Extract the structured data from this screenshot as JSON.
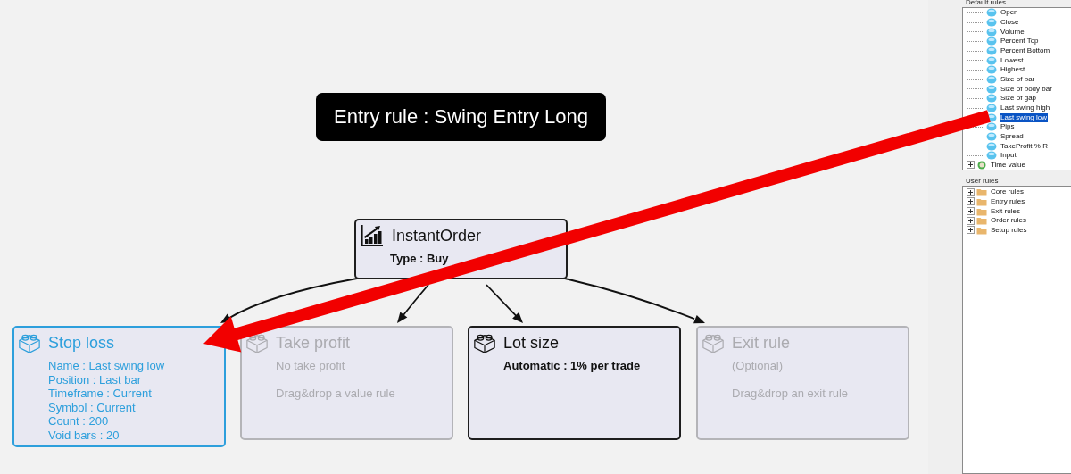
{
  "title": "Entry rule : Swing Entry Long",
  "order": {
    "name": "InstantOrder",
    "kind": "order",
    "selected": false,
    "disabled": false,
    "lines": [
      "Type : Buy"
    ],
    "children": [
      {
        "name": "Stop loss",
        "kind": "rule",
        "selected": true,
        "disabled": false,
        "lines": [
          "Name : Last swing low",
          "Position : Last bar",
          "Timeframe : Current",
          "Symbol : Current",
          "Count : 200",
          "Void bars : 20"
        ]
      },
      {
        "name": "Take profit",
        "kind": "rule",
        "selected": false,
        "disabled": true,
        "lines": [
          "No take profit",
          "Drag&drop a value rule"
        ]
      },
      {
        "name": "Lot size",
        "kind": "rule",
        "selected": false,
        "disabled": false,
        "lines": [
          "Automatic : 1% per trade"
        ]
      },
      {
        "name": "Exit rule",
        "kind": "rule",
        "selected": false,
        "disabled": true,
        "lines": [
          "(Optional)",
          "Drag&drop an exit rule"
        ]
      }
    ]
  },
  "default_rules": {
    "label": "Default rules",
    "items": [
      {
        "label": "Open",
        "kind": "rule",
        "selected": false
      },
      {
        "label": "Close",
        "kind": "rule",
        "selected": false
      },
      {
        "label": "Volume",
        "kind": "rule",
        "selected": false
      },
      {
        "label": "Percent Top",
        "kind": "rule",
        "selected": false
      },
      {
        "label": "Percent Bottom",
        "kind": "rule",
        "selected": false
      },
      {
        "label": "Lowest",
        "kind": "rule",
        "selected": false
      },
      {
        "label": "Highest",
        "kind": "rule",
        "selected": false
      },
      {
        "label": "Size of bar",
        "kind": "rule",
        "selected": false
      },
      {
        "label": "Size of body bar",
        "kind": "rule",
        "selected": false
      },
      {
        "label": "Size of gap",
        "kind": "rule",
        "selected": false
      },
      {
        "label": "Last swing high",
        "kind": "rule",
        "selected": false
      },
      {
        "label": "Last swing low",
        "kind": "rule",
        "selected": true
      },
      {
        "label": "Pips",
        "kind": "rule",
        "selected": false
      },
      {
        "label": "Spread",
        "kind": "rule",
        "selected": false
      },
      {
        "label": "TakeProfit % R",
        "kind": "rule",
        "selected": false
      },
      {
        "label": "Input",
        "kind": "rule",
        "selected": false
      },
      {
        "label": "Time value",
        "kind": "group",
        "selected": false,
        "expanded": false
      }
    ]
  },
  "user_rules": {
    "label": "User rules",
    "items": [
      {
        "label": "Core rules",
        "kind": "folder",
        "selected": false,
        "expanded": false
      },
      {
        "label": "Entry rules",
        "kind": "folder",
        "selected": false,
        "expanded": false
      },
      {
        "label": "Exit rules",
        "kind": "folder",
        "selected": false,
        "expanded": false
      },
      {
        "label": "Order rules",
        "kind": "folder",
        "selected": false,
        "expanded": false
      },
      {
        "label": "Setup rules",
        "kind": "folder",
        "selected": false,
        "expanded": false
      }
    ]
  }
}
